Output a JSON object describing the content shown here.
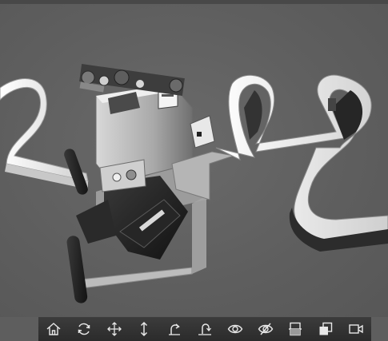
{
  "viewer": {
    "background_color": "#5e5e5e",
    "toolbar_color": "#333333",
    "icon_color": "#e8e8e8"
  },
  "toolbar": {
    "buttons": [
      {
        "icon": "home-icon"
      },
      {
        "icon": "rotate-icon"
      },
      {
        "icon": "pan-icon"
      },
      {
        "icon": "zoom-icon"
      },
      {
        "icon": "rotate-around-icon"
      },
      {
        "icon": "rotate-floor-icon"
      },
      {
        "icon": "show-icon"
      },
      {
        "icon": "hide-icon"
      },
      {
        "icon": "section-icon"
      },
      {
        "icon": "layers-icon"
      },
      {
        "icon": "camera-icon"
      }
    ]
  }
}
